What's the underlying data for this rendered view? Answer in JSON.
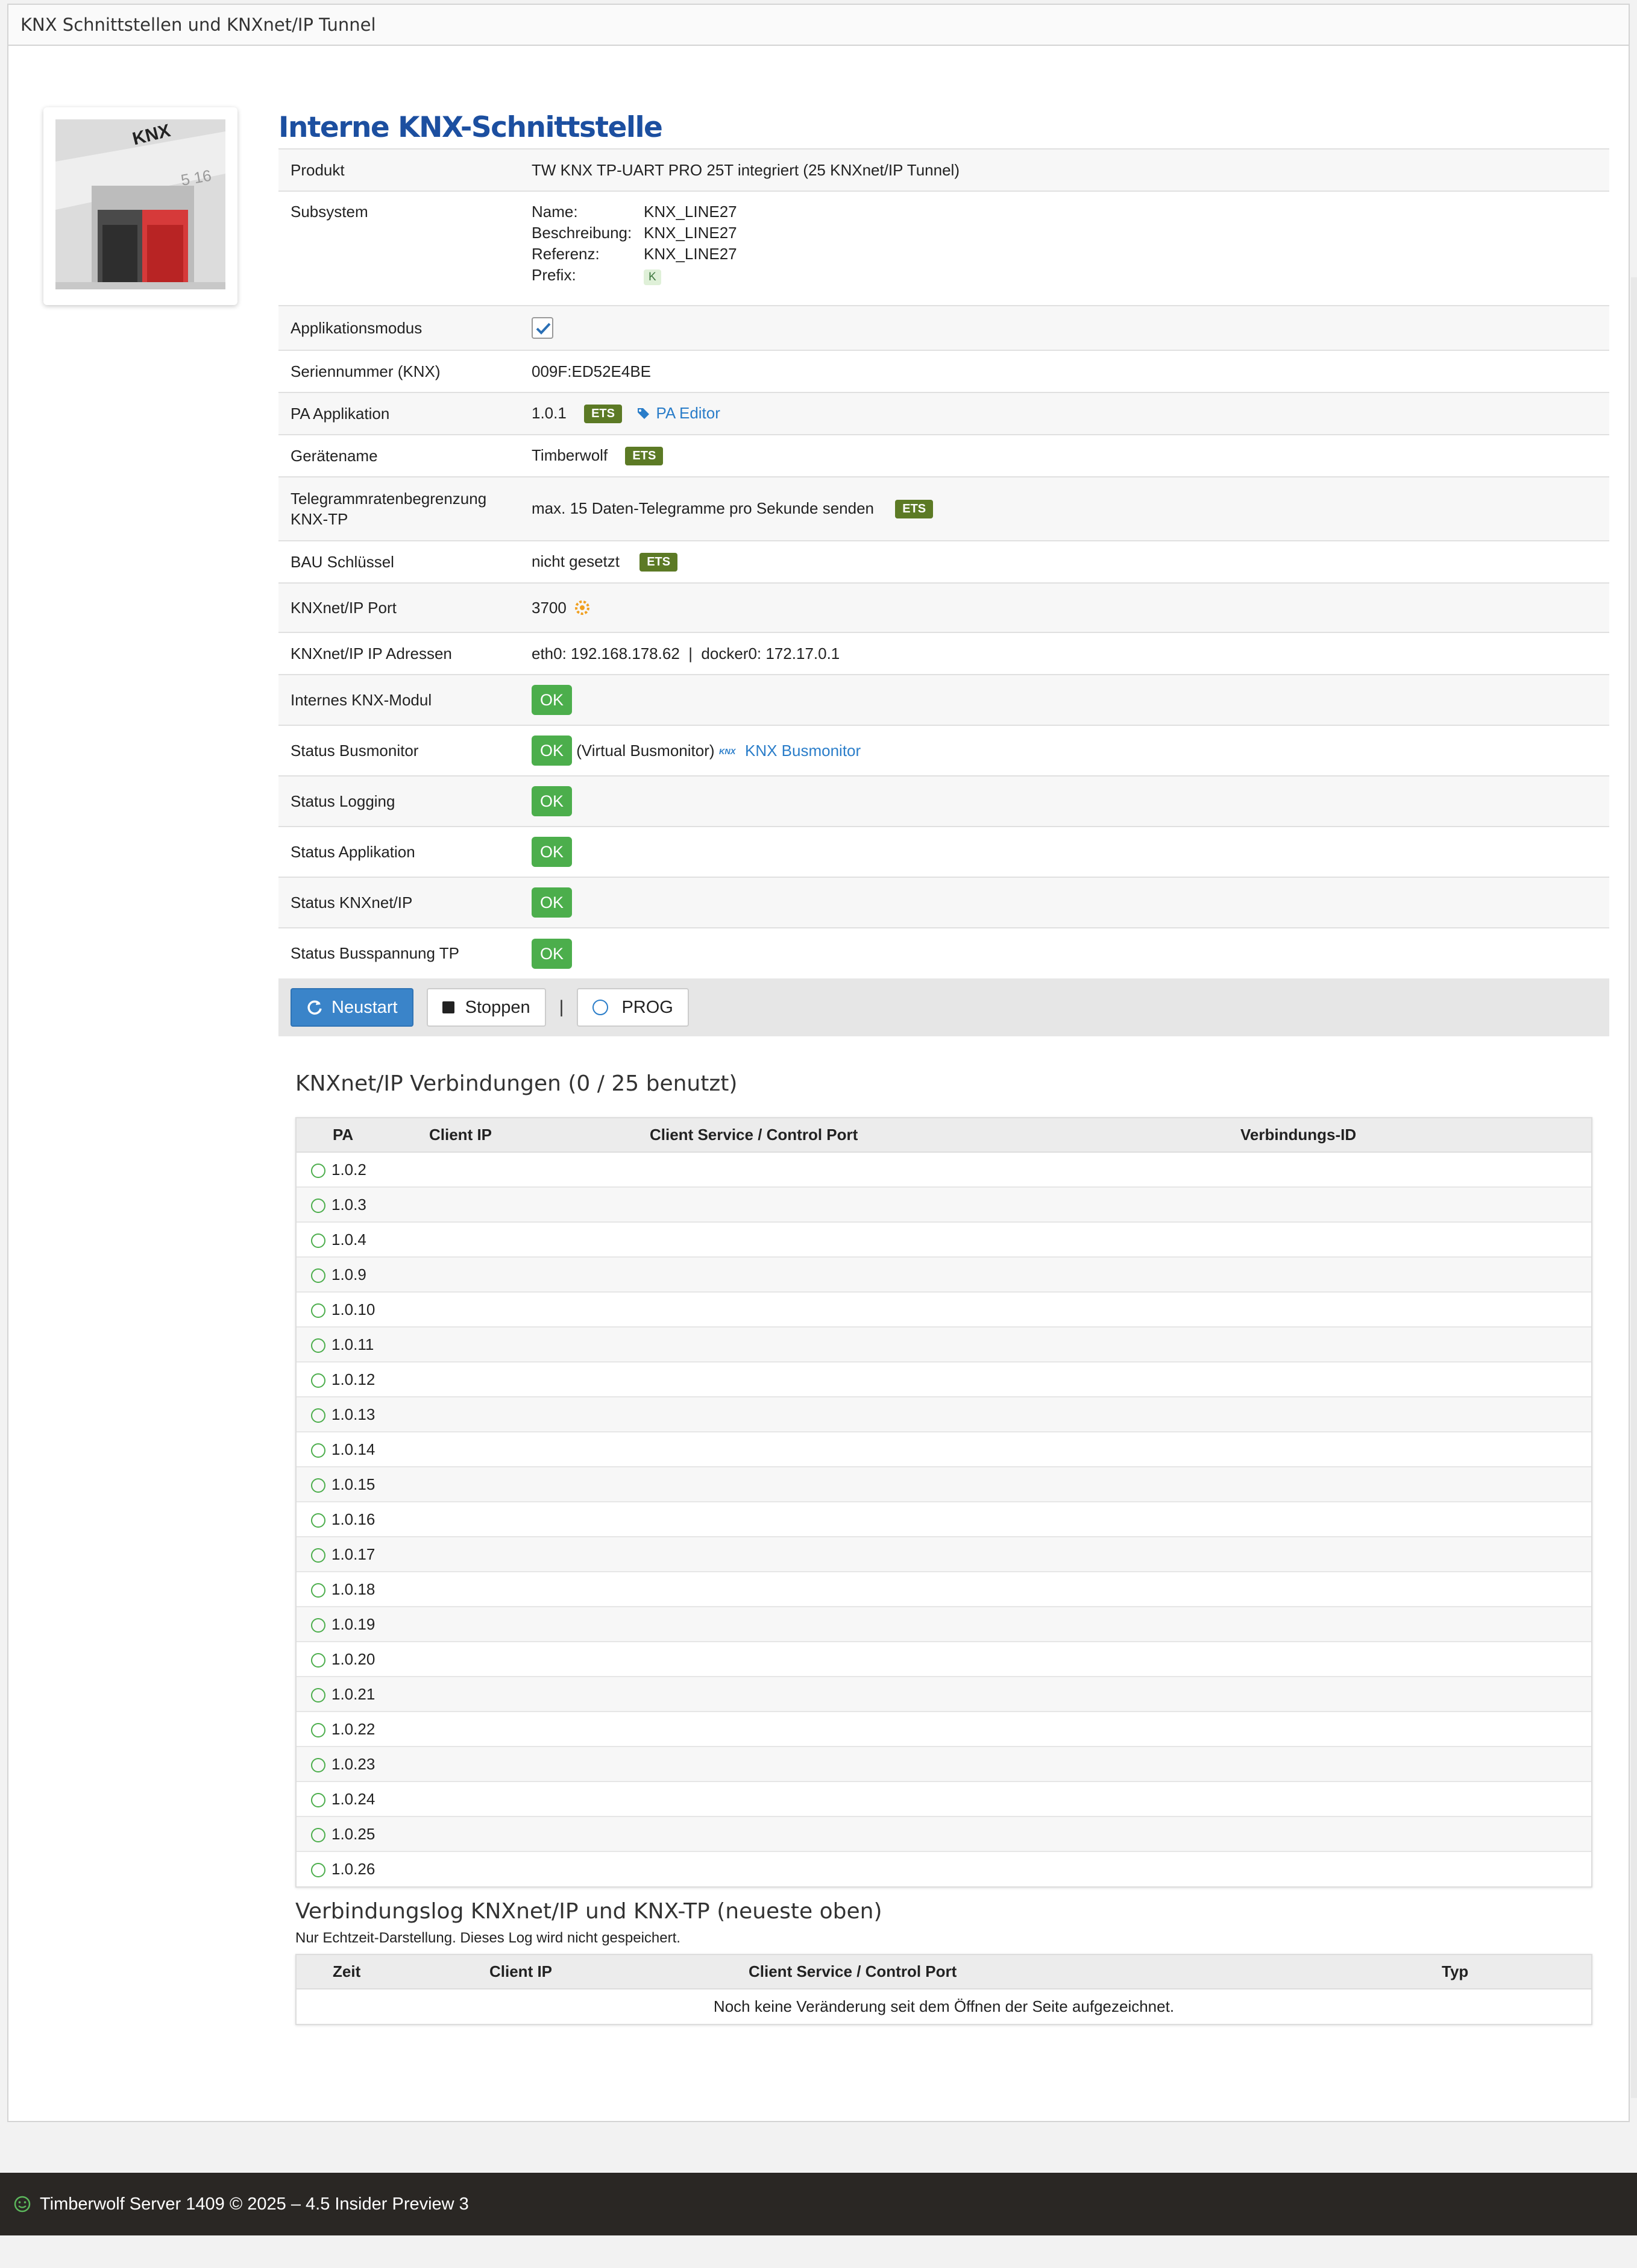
{
  "window": {
    "title": "KNX Schnittstellen und KNXnet/IP Tunnel"
  },
  "main": {
    "title": "Interne KNX-Schnittstelle",
    "product_label": "Produkt",
    "product_value": "TW KNX TP-UART PRO 25T integriert (25 KNXnet/IP Tunnel)",
    "subsystem_label": "Subsystem",
    "subsystem": {
      "name_label": "Name:",
      "name_value": "KNX_LINE27",
      "desc_label": "Beschreibung:",
      "desc_value": "KNX_LINE27",
      "ref_label": "Referenz:",
      "ref_value": "KNX_LINE27",
      "prefix_label": "Prefix:",
      "prefix_value": "K"
    },
    "appmode_label": "Applikationsmodus",
    "appmode_checked": true,
    "serial_label": "Seriennummer (KNX)",
    "serial_value": "009F:ED52E4BE",
    "pa_label": "PA Applikation",
    "pa_value": "1.0.1",
    "pa_editor_link": "PA Editor",
    "ets_badge": "ETS",
    "devname_label": "Gerätename",
    "devname_value": "Timberwolf",
    "rate_label_1": "Telegrammratenbegrenzung",
    "rate_label_2": "KNX-TP",
    "rate_value": "max. 15 Daten-Telegramme pro Sekunde senden",
    "bau_label": "BAU Schlüssel",
    "bau_value": "nicht gesetzt",
    "port_label": "KNXnet/IP Port",
    "port_value": "3700",
    "ip_label": "KNXnet/IP IP Adressen",
    "ip_value": "eth0: 192.168.178.62  |  docker0: 172.17.0.1",
    "ok_label": "OK",
    "module_label": "Internes KNX-Modul",
    "busmon_label": "Status Busmonitor",
    "busmon_extra": "(Virtual Busmonitor)",
    "busmon_link": "KNX Busmonitor",
    "logging_label": "Status Logging",
    "application_label": "Status Applikation",
    "knxnet_label": "Status KNXnet/IP",
    "busvolt_label": "Status Busspannung TP"
  },
  "buttons": {
    "restart": "Neustart",
    "stop": "Stoppen",
    "separator": "|",
    "prog": "PROG"
  },
  "connections": {
    "title": "KNXnet/IP Verbindungen (0 / 25 benutzt)",
    "columns": [
      "PA",
      "Client IP",
      "Client Service / Control Port",
      "Verbindungs-ID"
    ],
    "rows": [
      "1.0.2",
      "1.0.3",
      "1.0.4",
      "1.0.9",
      "1.0.10",
      "1.0.11",
      "1.0.12",
      "1.0.13",
      "1.0.14",
      "1.0.15",
      "1.0.16",
      "1.0.17",
      "1.0.18",
      "1.0.19",
      "1.0.20",
      "1.0.21",
      "1.0.22",
      "1.0.23",
      "1.0.24",
      "1.0.25",
      "1.0.26"
    ]
  },
  "log": {
    "title": "Verbindungslog KNXnet/IP und KNX-TP (neueste oben)",
    "note": "Nur Echtzeit-Darstellung. Dieses Log wird nicht gespeichert.",
    "columns": [
      "Zeit",
      "Client IP",
      "Client Service / Control Port",
      "Typ"
    ],
    "empty": "Noch keine Veränderung seit dem Öffnen der Seite aufgezeichnet."
  },
  "footer": {
    "text": "Timberwolf Server 1409 © 2025 – 4.5 Insider Preview 3"
  },
  "product_image": {
    "logo_text": "KNX",
    "label_text": "5  16"
  },
  "colors": {
    "title_blue": "#1c4fa0",
    "ok_green": "#4cae4c",
    "ets_olive": "#5c7a25",
    "link_blue": "#2a7dc9",
    "footer_bg": "#2a2724"
  }
}
